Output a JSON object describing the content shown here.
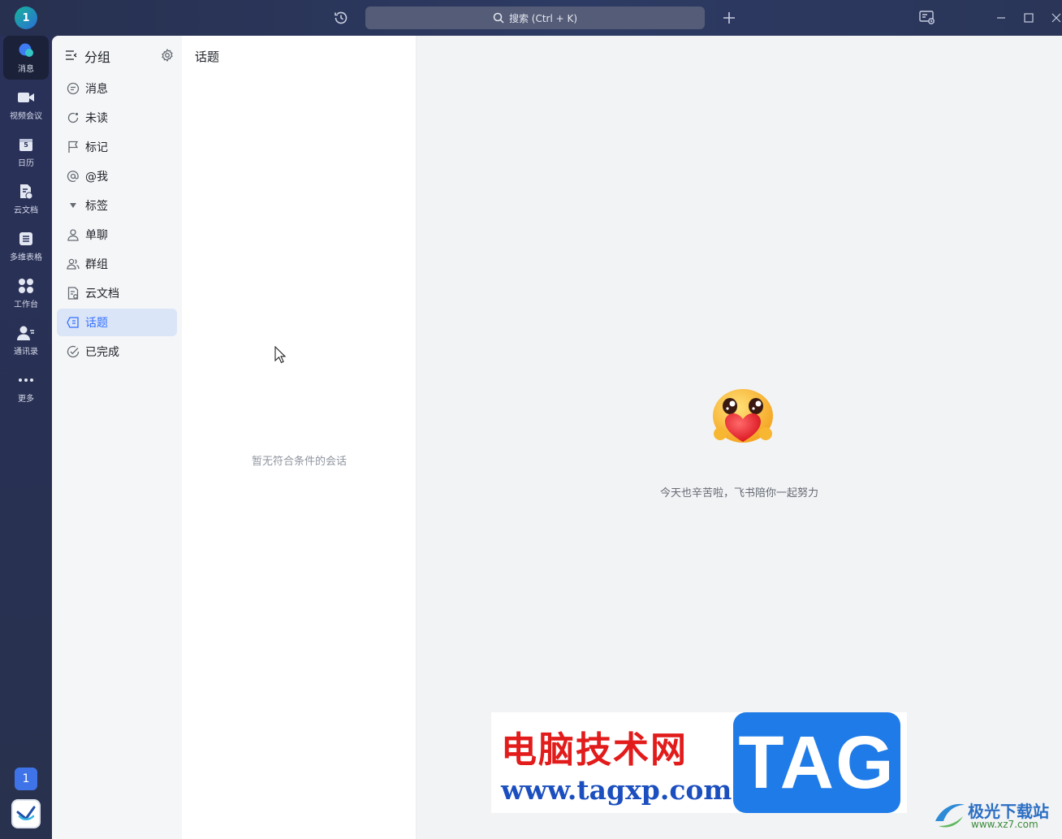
{
  "titlebar": {
    "avatar_initial": "1",
    "search_placeholder": "搜索 (Ctrl + K)"
  },
  "rail": {
    "items": [
      {
        "label": "消息",
        "icon": "chat-bubble-icon",
        "active": true
      },
      {
        "label": "视频会议",
        "icon": "video-camera-icon"
      },
      {
        "label": "日历",
        "icon": "calendar-icon",
        "calendar_day": "5"
      },
      {
        "label": "云文档",
        "icon": "cloud-doc-icon"
      },
      {
        "label": "多维表格",
        "icon": "table-icon"
      },
      {
        "label": "工作台",
        "icon": "grid-icon"
      },
      {
        "label": "通讯录",
        "icon": "contacts-icon"
      },
      {
        "label": "更多",
        "icon": "more-dots-icon"
      }
    ],
    "badge": "1"
  },
  "groups": {
    "title": "分组",
    "items": [
      {
        "label": "消息",
        "icon": "message-icon"
      },
      {
        "label": "未读",
        "icon": "unread-icon"
      },
      {
        "label": "标记",
        "icon": "flag-icon"
      },
      {
        "label": "@我",
        "icon": "at-icon"
      },
      {
        "label": "标签",
        "icon": "caret-down-icon"
      },
      {
        "label": "单聊",
        "icon": "person-icon"
      },
      {
        "label": "群组",
        "icon": "group-icon"
      },
      {
        "label": "云文档",
        "icon": "doc-icon"
      },
      {
        "label": "话题",
        "icon": "topic-icon",
        "active": true
      },
      {
        "label": "已完成",
        "icon": "check-circle-icon"
      }
    ]
  },
  "topics": {
    "title": "话题",
    "empty_text": "暂无符合条件的会话"
  },
  "main": {
    "message": "今天也辛苦啦，飞书陪你一起努力"
  },
  "watermark": {
    "cn_text": "电脑技术网",
    "url_text": "www.tagxp.com",
    "tag_text": "TAG",
    "site_name": "极光下载站",
    "site_url": "www.xz7.com"
  },
  "colors": {
    "accent": "#3370ff",
    "rail_bg": "#29315a",
    "active_group_bg": "#dbe5f8"
  }
}
